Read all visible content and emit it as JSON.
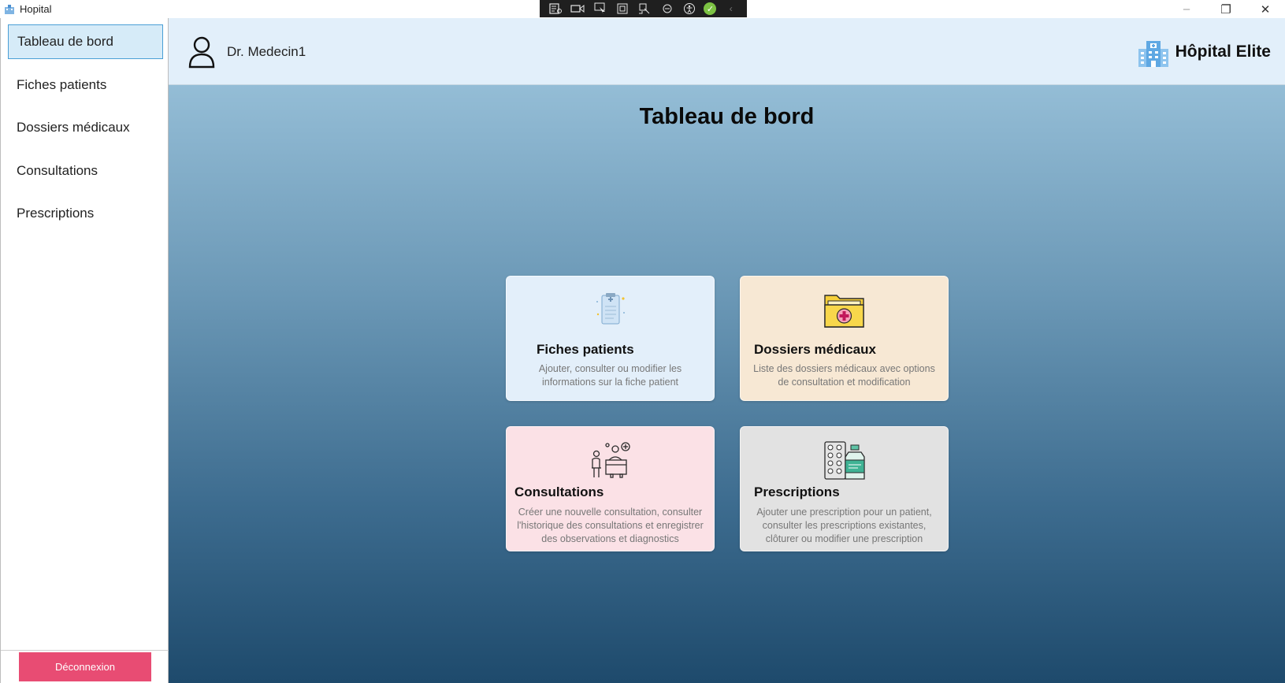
{
  "window": {
    "title": "Hopital",
    "controls": {
      "minimize": "–",
      "restore": "❐",
      "close": "✕"
    }
  },
  "debug_toolbar": {
    "icons": [
      "live-visual-tree-icon",
      "record-icon",
      "select-element-icon",
      "display-layout-adorners-icon",
      "track-focus-icon",
      "hot-reload-icon",
      "accessibility-icon",
      "ok-check-icon",
      "collapse-chevron-icon"
    ]
  },
  "sidebar": {
    "items": [
      {
        "label": "Tableau de bord",
        "active": true
      },
      {
        "label": "Fiches patients",
        "active": false
      },
      {
        "label": "Dossiers médicaux",
        "active": false
      },
      {
        "label": "Consultations",
        "active": false
      },
      {
        "label": "Prescriptions",
        "active": false
      }
    ],
    "logout_label": "Déconnexion",
    "logout_color": "#e84c73",
    "active_color": "#d6ebf8"
  },
  "header": {
    "user_name": "Dr. Medecin1",
    "hospital_name": "Hôpital Elite"
  },
  "main": {
    "title": "Tableau de bord",
    "cards": [
      {
        "title": "Fiches patients",
        "description": "Ajouter, consulter ou modifier les informations sur la fiche patient",
        "icon": "clipboard-medical-icon",
        "color": "#e3effa"
      },
      {
        "title": "Dossiers médicaux",
        "description": "Liste des dossiers médicaux avec options de consultation et modification",
        "icon": "medical-folder-icon",
        "color": "#f7e8d4"
      },
      {
        "title": "Consultations",
        "description": "Créer une nouvelle consultation, consulter l'historique des consultations et enregistrer des observations et diagnostics",
        "icon": "doctor-consultation-icon",
        "color": "#fbe1e6"
      },
      {
        "title": "Prescriptions",
        "description": "Ajouter une prescription pour un patient, consulter les prescriptions existantes, clôturer ou modifier une prescription",
        "icon": "pills-bottle-icon",
        "color": "#e2e2e2"
      }
    ]
  }
}
